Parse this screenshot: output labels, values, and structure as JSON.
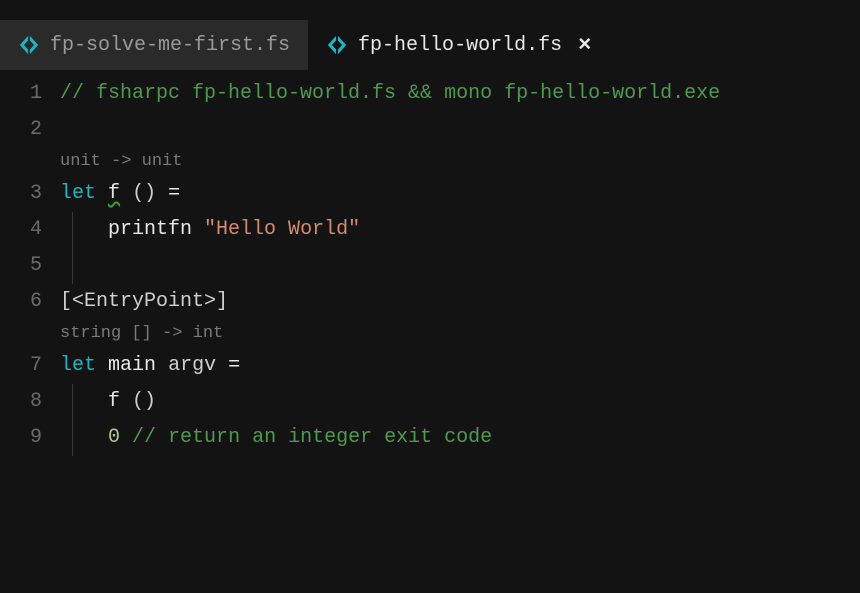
{
  "tabs": [
    {
      "label": "fp-solve-me-first.fs",
      "active": false
    },
    {
      "label": "fp-hello-world.fs",
      "active": true
    }
  ],
  "close_glyph": "×",
  "lines": {
    "ln1": "1",
    "ln2": "2",
    "ln3": "3",
    "ln4": "4",
    "ln5": "5",
    "ln6": "6",
    "ln7": "7",
    "ln8": "8",
    "ln9": "9"
  },
  "code": {
    "comment1": "// fsharpc fp-hello-world.fs && mono fp-hello-world.exe",
    "hint1": "unit -> unit",
    "kw_let1": "let",
    "fn_f": "f",
    "unit1": "()",
    "eq1": "=",
    "printfn": "printfn",
    "string1": "\"Hello World\"",
    "attr": "[<EntryPoint>]",
    "hint2": "string [] -> int",
    "kw_let2": "let",
    "fn_main": "main",
    "argv": "argv",
    "eq2": "=",
    "call_f": "f",
    "unit2": "()",
    "zero": "0",
    "comment2": "// return an integer exit code"
  }
}
